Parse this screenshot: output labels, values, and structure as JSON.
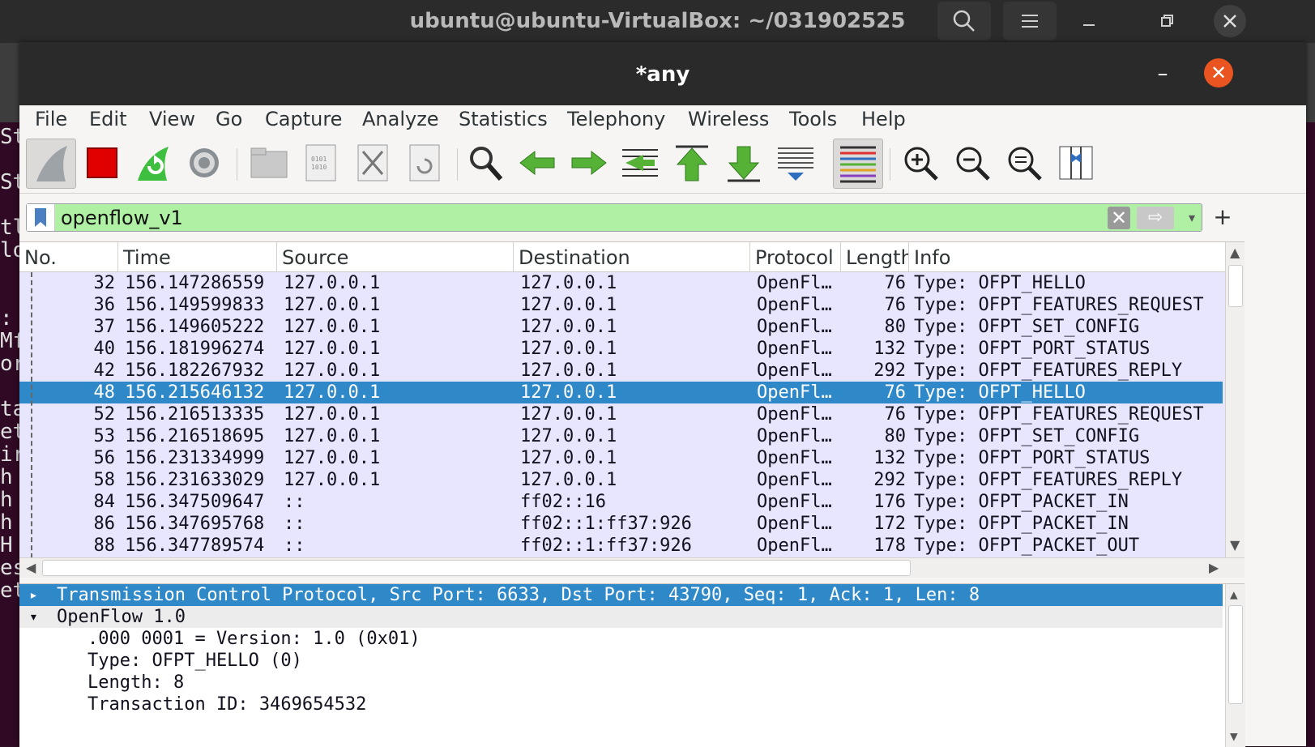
{
  "terminal": {
    "title": "ubuntu@ubuntu-VirtualBox: ~/031902525",
    "edge_chars": [
      "St",
      "",
      "St",
      "",
      "tl",
      "lo",
      "",
      "",
      ":",
      "Mf",
      "or",
      "",
      "ta",
      "et",
      "ir",
      "h",
      "h",
      "h",
      "H",
      "es",
      "et"
    ]
  },
  "window": {
    "title": "*any",
    "minimize_label": "–",
    "close_label": "✕"
  },
  "menu": [
    "File",
    "Edit",
    "View",
    "Go",
    "Capture",
    "Analyze",
    "Statistics",
    "Telephony",
    "Wireless",
    "Tools",
    "Help"
  ],
  "toolbar": {
    "icons": [
      "shark-fin-icon",
      "stop-icon",
      "restart-icon",
      "options-gear-icon",
      "open-file-icon",
      "save-file-icon",
      "close-file-icon",
      "reload-file-icon",
      "find-packet-icon",
      "go-back-icon",
      "go-forward-icon",
      "go-to-packet-icon",
      "first-packet-icon",
      "last-packet-icon",
      "autoscroll-icon",
      "colorize-icon",
      "zoom-in-icon",
      "zoom-out-icon",
      "normal-size-icon",
      "resize-columns-icon"
    ]
  },
  "filter": {
    "value": "openflow_v1",
    "clear_label": "✕",
    "apply_label": "⇨",
    "dropdown_label": "▾",
    "add_label": "+"
  },
  "packet_list": {
    "columns": [
      "No.",
      "Time",
      "Source",
      "Destination",
      "Protocol",
      "Length",
      "Info"
    ],
    "rows": [
      {
        "no": "32",
        "time": "156.147286559",
        "src": "127.0.0.1",
        "dst": "127.0.0.1",
        "proto": "OpenFl…",
        "len": "76",
        "info": "Type: OFPT_HELLO"
      },
      {
        "no": "36",
        "time": "156.149599833",
        "src": "127.0.0.1",
        "dst": "127.0.0.1",
        "proto": "OpenFl…",
        "len": "76",
        "info": "Type: OFPT_FEATURES_REQUEST"
      },
      {
        "no": "37",
        "time": "156.149605222",
        "src": "127.0.0.1",
        "dst": "127.0.0.1",
        "proto": "OpenFl…",
        "len": "80",
        "info": "Type: OFPT_SET_CONFIG"
      },
      {
        "no": "40",
        "time": "156.181996274",
        "src": "127.0.0.1",
        "dst": "127.0.0.1",
        "proto": "OpenFl…",
        "len": "132",
        "info": "Type: OFPT_PORT_STATUS"
      },
      {
        "no": "42",
        "time": "156.182267932",
        "src": "127.0.0.1",
        "dst": "127.0.0.1",
        "proto": "OpenFl…",
        "len": "292",
        "info": "Type: OFPT_FEATURES_REPLY"
      },
      {
        "no": "48",
        "time": "156.215646132",
        "src": "127.0.0.1",
        "dst": "127.0.0.1",
        "proto": "OpenFl…",
        "len": "76",
        "info": "Type: OFPT_HELLO"
      },
      {
        "no": "52",
        "time": "156.216513335",
        "src": "127.0.0.1",
        "dst": "127.0.0.1",
        "proto": "OpenFl…",
        "len": "76",
        "info": "Type: OFPT_FEATURES_REQUEST"
      },
      {
        "no": "53",
        "time": "156.216518695",
        "src": "127.0.0.1",
        "dst": "127.0.0.1",
        "proto": "OpenFl…",
        "len": "80",
        "info": "Type: OFPT_SET_CONFIG"
      },
      {
        "no": "56",
        "time": "156.231334999",
        "src": "127.0.0.1",
        "dst": "127.0.0.1",
        "proto": "OpenFl…",
        "len": "132",
        "info": "Type: OFPT_PORT_STATUS"
      },
      {
        "no": "58",
        "time": "156.231633029",
        "src": "127.0.0.1",
        "dst": "127.0.0.1",
        "proto": "OpenFl…",
        "len": "292",
        "info": "Type: OFPT_FEATURES_REPLY"
      },
      {
        "no": "84",
        "time": "156.347509647",
        "src": "::",
        "dst": "ff02::16",
        "proto": "OpenFl…",
        "len": "176",
        "info": "Type: OFPT_PACKET_IN"
      },
      {
        "no": "86",
        "time": "156.347695768",
        "src": "::",
        "dst": "ff02::1:ff37:926",
        "proto": "OpenFl…",
        "len": "172",
        "info": "Type: OFPT_PACKET_IN"
      },
      {
        "no": "88",
        "time": "156.347789574",
        "src": "::",
        "dst": "ff02::1:ff37:926",
        "proto": "OpenFl…",
        "len": "178",
        "info": "Type: OFPT_PACKET_OUT"
      }
    ],
    "selected_index": 5
  },
  "details": {
    "lines": [
      {
        "text": "Transmission Control Protocol, Src Port: 6633, Dst Port: 43790, Seq: 1, Ack: 1, Len: 8",
        "expander": "▸",
        "indent": 0,
        "state": "selected"
      },
      {
        "text": "OpenFlow 1.0",
        "expander": "▾",
        "indent": 0,
        "state": "grey"
      },
      {
        "text": ".000 0001 = Version: 1.0 (0x01)",
        "expander": "",
        "indent": 1,
        "state": "normal"
      },
      {
        "text": "Type: OFPT_HELLO (0)",
        "expander": "",
        "indent": 1,
        "state": "normal"
      },
      {
        "text": "Length: 8",
        "expander": "",
        "indent": 1,
        "state": "normal"
      },
      {
        "text": "Transaction ID: 3469654532",
        "expander": "",
        "indent": 1,
        "state": "normal"
      }
    ]
  },
  "colors": {
    "row_bg": "#e7e6fe",
    "selected": "#2f89c9",
    "filter_ok": "#aff0a4",
    "close_btn": "#e95420"
  }
}
